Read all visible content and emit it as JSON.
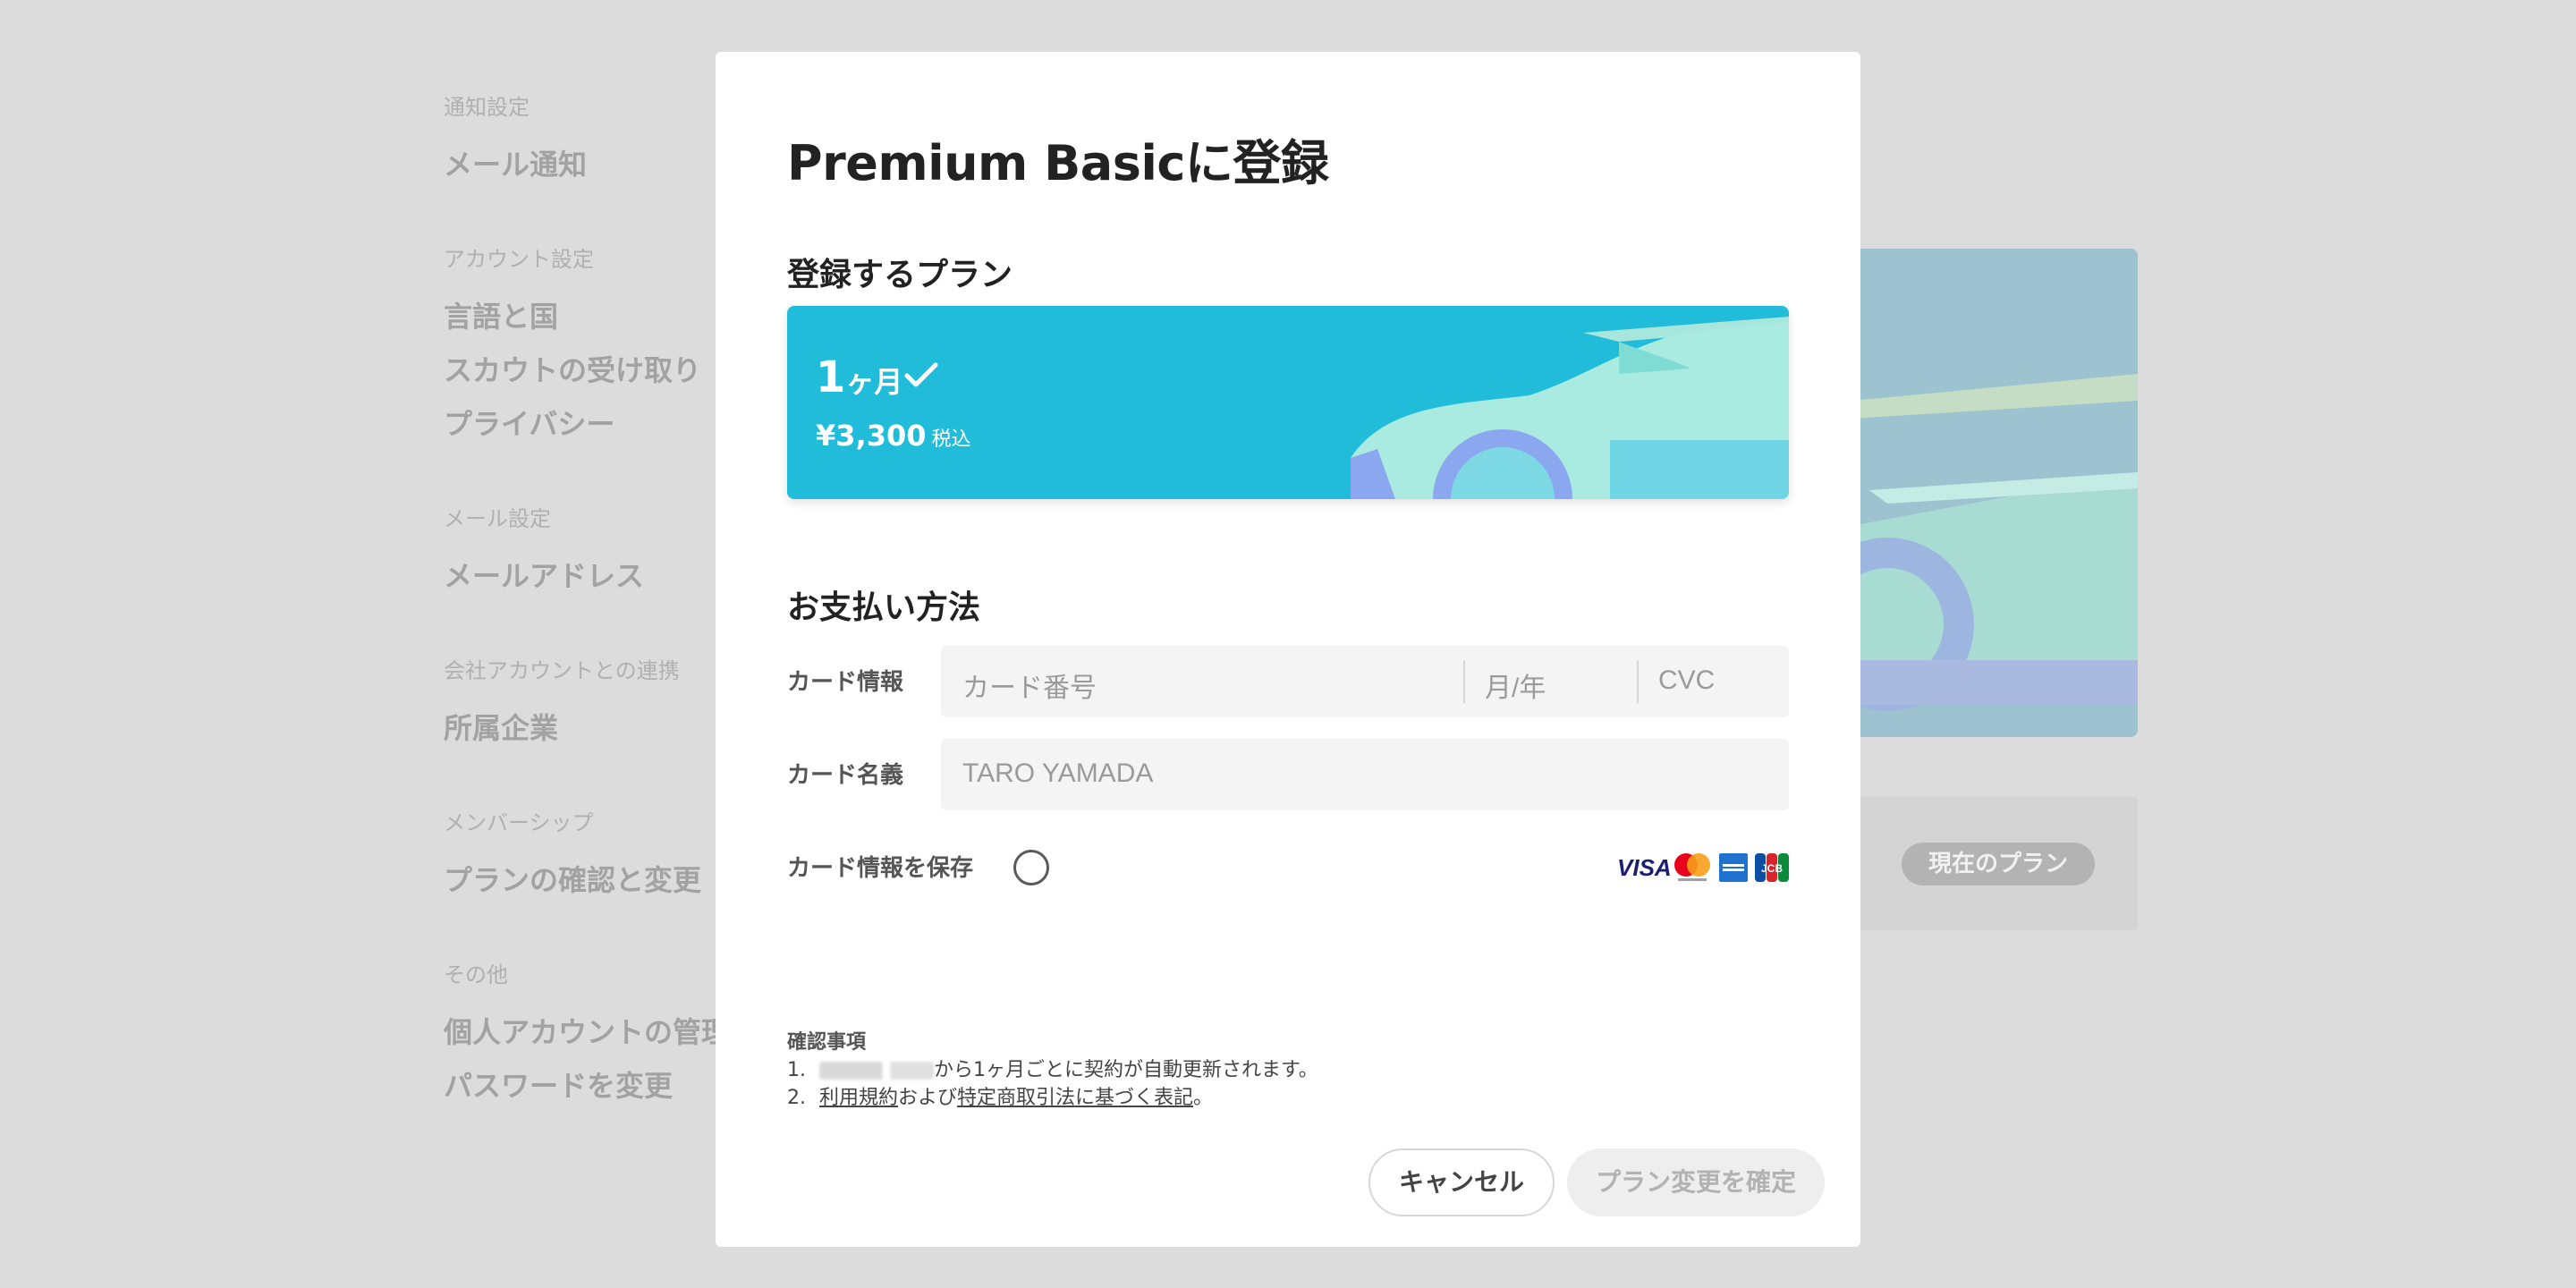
{
  "background": {
    "sidebar": [
      {
        "heading": "通知設定",
        "items": [
          "メール通知"
        ]
      },
      {
        "heading": "アカウント設定",
        "items": [
          "言語と国",
          "スカウトの受け取り",
          "プライバシー"
        ]
      },
      {
        "heading": "メール設定",
        "items": [
          "メールアドレス"
        ]
      },
      {
        "heading": "会社アカウントとの連携",
        "items": [
          "所属企業"
        ]
      },
      {
        "heading": "メンバーシップ",
        "items": [
          "プランの確認と変更"
        ]
      },
      {
        "heading": "その他",
        "items": [
          "個人アカウントの管理",
          "パスワードを変更"
        ]
      }
    ],
    "current_plan_badge": "現在のプラン"
  },
  "modal": {
    "title": "Premium Basicに登録",
    "plan_section_title": "登録するプラン",
    "plan": {
      "duration_number": "1",
      "duration_unit": "ヶ月",
      "price": "¥3,300",
      "tax_note": "税込",
      "selected_icon": "check-icon"
    },
    "payment_section_title": "お支払い方法",
    "card_info_label": "カード情報",
    "card_number_placeholder": "カード番号",
    "expiry_placeholder": "月/年",
    "cvc_placeholder": "CVC",
    "card_name_label": "カード名義",
    "card_name_placeholder": "TARO YAMADA",
    "save_card_label": "カード情報を保存",
    "card_brands": [
      "VISA",
      "Mastercard",
      "American Express",
      "JCB"
    ],
    "notes": {
      "heading": "確認事項",
      "item1_num": "1.",
      "item1_text": "から1ヶ月ごとに契約が自動更新されます。",
      "item2_num": "2.",
      "item2_link1": "利用規約",
      "item2_mid": "および",
      "item2_link2": "特定商取引法に基づく表記",
      "item2_end": "。"
    },
    "cancel_button": "キャンセル",
    "confirm_button": "プラン変更を確定"
  },
  "colors": {
    "overlay": "#dcdcdc",
    "plan_card": "#21bcda",
    "field_bg": "#f4f4f4"
  }
}
